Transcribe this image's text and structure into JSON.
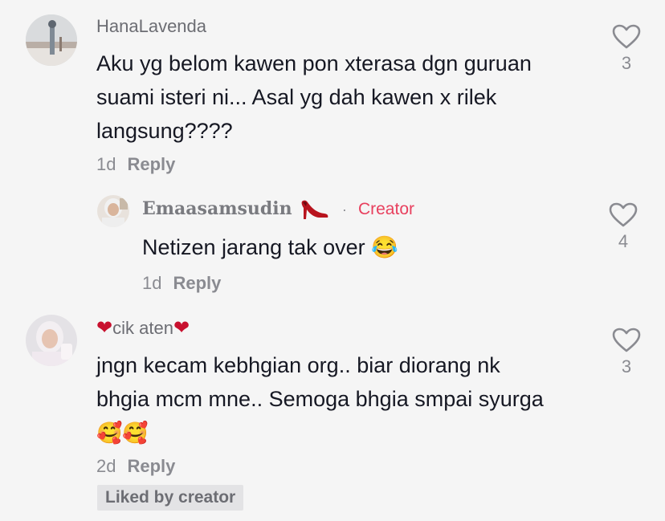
{
  "comments": [
    {
      "username": "HanaLavenda",
      "text": "Aku yg belom kawen pon xterasa dgn guruan suami isteri ni... Asal yg dah kawen x rilek langsung????",
      "lines": [
        "Aku yg belom kawen pon xterasa dgn guruan",
        "suami isteri ni... Asal yg dah kawen x rilek",
        "langsung????"
      ],
      "time": "1d",
      "reply_label": "Reply",
      "likes": "3"
    },
    {
      "username": "Emaasamsudin",
      "creator_label": "Creator",
      "dot": "·",
      "text": "Netizen jarang tak over 😂",
      "time": "1d",
      "reply_label": "Reply",
      "likes": "4"
    },
    {
      "username_prefix": "❤",
      "username": "cik aten",
      "username_suffix": "❤",
      "lines": [
        "jngn kecam kebhgian org.. biar diorang nk",
        "bhgia mcm mne.. Semoga bhgia smpai syurga",
        "🥰🥰"
      ],
      "time": "2d",
      "reply_label": "Reply",
      "likes": "3",
      "badge": "Liked by creator"
    }
  ],
  "colors": {
    "background": "#f5f5f5",
    "text": "#161823",
    "muted": "#8a8b91",
    "creator": "#e8405e"
  }
}
